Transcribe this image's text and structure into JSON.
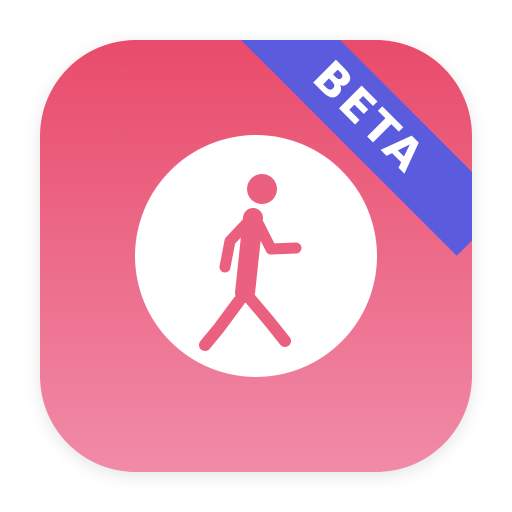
{
  "icon": {
    "badge_label": "BETA",
    "symbol": "walking-person-icon"
  },
  "colors": {
    "gradient_top": "#e94b6b",
    "gradient_bottom": "#f08ba8",
    "ribbon": "#5b5cdd",
    "circle": "#ffffff",
    "figure": "#eb5f7f"
  }
}
